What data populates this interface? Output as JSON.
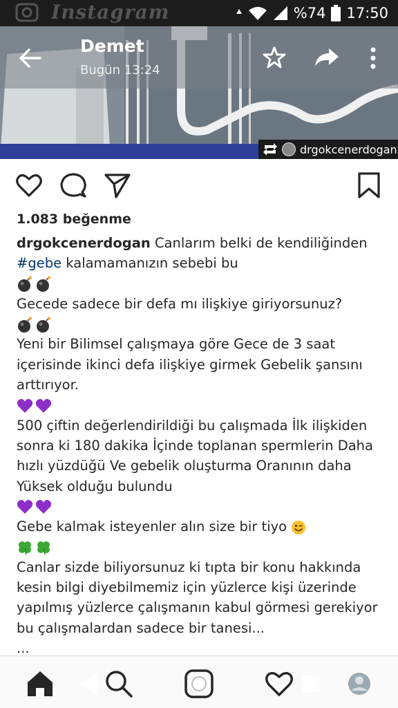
{
  "status_bar": {
    "brand": "Instagram",
    "battery": "%74",
    "time": "17:50",
    "icons": [
      "camera-icon",
      "signal-arrow-icon",
      "wifi-icon",
      "cell-signal-icon",
      "battery-icon"
    ]
  },
  "chat_header": {
    "title": "Demet",
    "subtitle": "Bugün 13:24",
    "icons": [
      "back-arrow-icon",
      "star-icon",
      "share-icon",
      "more-vert-icon"
    ]
  },
  "media": {
    "repost_username": "drgokcenerdogan",
    "repost_icon": "repost-icon"
  },
  "post_actions": {
    "icons": [
      "heart-icon",
      "comment-icon",
      "send-icon",
      "bookmark-icon"
    ]
  },
  "post": {
    "likes": "1.083 beğenme",
    "username": "drgokcenerdogan",
    "caption_first": " Canlarım belki de kendiliğinden",
    "hashtag": "#gebe",
    "caption_second": " kalamamanızın sebebi bu",
    "lines": {
      "q1": "Gecede sadece bir defa mı ilişkiye giriyorsunuz?",
      "p1a": "Yeni bir Bilimsel çalışmaya göre Gece de 3 saat",
      "p1b": "içerisinde ikinci defa ilişkiye girmek Gebelik şansını",
      "p1c": "arttırıyor.",
      "p2a": "500 çiftin değerlendirildiği bu çalışmada İlk ilişkiden",
      "p2b": "sonra ki 180 dakika İçinde toplanan spermlerin Daha",
      "p2c": "hızlı yüzdüğü  Ve gebelik oluşturma Oranının daha",
      "p2d": "Yüksek olduğu  bulundu",
      "p3": "Gebe kalmak isteyenler alın size bir tiyo ",
      "p4a": "Canlar sizde biliyorsunuz ki tıpta bir konu hakkında",
      "p4b": "kesin bilgi diyebilmemiz için yüzlerce kişi üzerinde",
      "p4c": "yapılmış yüzlerce çalışmanın kabul görmesi gerekiyor",
      "p4d": "bu çalışmalardan sadece bir tanesi...",
      "more": "..."
    },
    "emoji_names": [
      "bomb-emoji",
      "purple-heart-emoji",
      "wink-emoji",
      "clover-emoji"
    ]
  },
  "bottom_nav": {
    "icons": [
      "home-icon",
      "back-triangle-icon",
      "search-icon",
      "camera-ring-icon",
      "heart-icon",
      "recents-square-icon",
      "profile-avatar"
    ]
  },
  "colors": {
    "status_bg": "#1c1c1c",
    "text": "#262626",
    "hashtag": "#003569",
    "purple_heart": "#8e2ec9",
    "clover": "#3aa832"
  }
}
